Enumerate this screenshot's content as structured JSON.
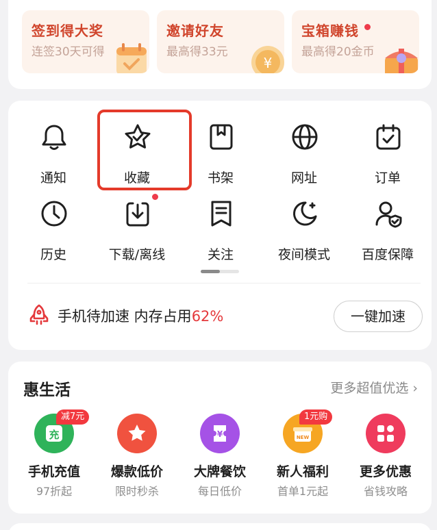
{
  "promos": [
    {
      "title": "签到得大奖",
      "subtitle": "连签30天可得",
      "art": "calendar-gift-icon"
    },
    {
      "title": "邀请好友",
      "subtitle": "最高得33元",
      "art": "coin-icon"
    },
    {
      "title": "宝箱赚钱",
      "subtitle": "最高得20金币",
      "art": "treasure-chest-icon",
      "has_dot": true
    }
  ],
  "tools": [
    {
      "label": "通知",
      "icon": "bell-icon"
    },
    {
      "label": "收藏",
      "icon": "star-check-icon",
      "highlighted": true
    },
    {
      "label": "书架",
      "icon": "bookmark-book-icon"
    },
    {
      "label": "网址",
      "icon": "globe-icon"
    },
    {
      "label": "订单",
      "icon": "calendar-check-icon"
    },
    {
      "label": "历史",
      "icon": "clock-icon"
    },
    {
      "label": "下载/离线",
      "icon": "download-icon",
      "has_dot": true
    },
    {
      "label": "关注",
      "icon": "list-bookmark-icon"
    },
    {
      "label": "夜间模式",
      "icon": "moon-icon"
    },
    {
      "label": "百度保障",
      "icon": "user-shield-icon"
    }
  ],
  "speedup": {
    "text": "手机待加速 内存占用",
    "percent": "62%",
    "button": "一键加速",
    "icon": "rocket-icon"
  },
  "life": {
    "title": "惠生活",
    "more": "更多超值优选 ›",
    "items": [
      {
        "name": "手机充值",
        "sub": "97折起",
        "badge": "减7元",
        "icon": "recharge-icon",
        "color": "#2fb35a"
      },
      {
        "name": "爆款低价",
        "sub": "限时秒杀",
        "badge": "",
        "icon": "star-icon",
        "color": "#f0523f"
      },
      {
        "name": "大牌餐饮",
        "sub": "每日低价",
        "badge": "",
        "icon": "ticket-icon",
        "color": "#a552e6"
      },
      {
        "name": "新人福利",
        "sub": "首单1元起",
        "badge": "1元购",
        "icon": "new-gift-icon",
        "color": "#f6a623"
      },
      {
        "name": "更多优惠",
        "sub": "省钱攻略",
        "badge": "",
        "icon": "grid-icon",
        "color": "#ef3b5d"
      }
    ]
  },
  "colors": {
    "accent_red": "#e4393c",
    "promo_title": "#d0452c",
    "highlight_border": "#e43a2a"
  }
}
